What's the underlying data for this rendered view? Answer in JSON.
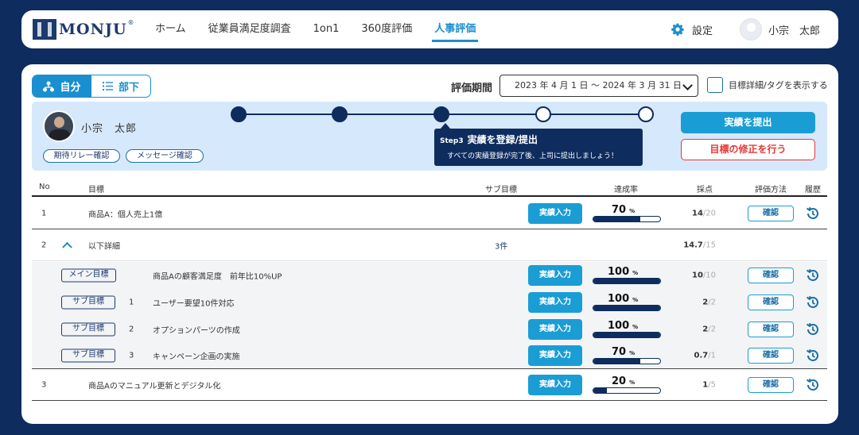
{
  "header": {
    "logo_text": "MONJU",
    "logo_reg": "®",
    "nav": [
      "ホーム",
      "従業員満足度調査",
      "1on1",
      "360度評価",
      "人事評価"
    ],
    "active_nav": "人事評価",
    "settings_label": "設定",
    "user_name": "小宗　太郎"
  },
  "toolbar": {
    "self_label": "自分",
    "subordinate_label": "部下",
    "period_label": "評価期間",
    "period_value": "2023 年 4 月 1 日 〜 2024 年 3 月 31 日",
    "show_detail_label": "目標詳細/タグを表示する"
  },
  "step_panel": {
    "person_name": "小宗　太郎",
    "relay_button": "期待リレー確認",
    "message_button": "メッセージ確認",
    "steps_total": 5,
    "steps_completed": 3,
    "tip_step": "Step3",
    "tip_title": "実績を登録/提出",
    "tip_desc": "すべての実績登録が完了後、上司に提出しましょう！",
    "submit_button": "実績を提出",
    "fix_button": "目標の修正を行う"
  },
  "table": {
    "headers": {
      "no": "No",
      "goal": "目標",
      "sub_goal": "サブ目標",
      "rate": "達成率",
      "score": "採点",
      "method": "評価方法",
      "history": "履歴"
    },
    "input_label": "実績入力",
    "confirm_label": "確認",
    "percent_sign": "%",
    "rows": [
      {
        "no": "1",
        "goal": "商品A：個人売上1億",
        "rate": 70,
        "score": "14",
        "score_max": "/20"
      },
      {
        "no": "2",
        "goal": "以下詳細",
        "sub_count": "3件",
        "score": "14.7",
        "score_max": "/15"
      },
      {
        "tag": "メイン目標",
        "goal": "商品Aの顧客満足度　前年比10%UP",
        "rate": 100,
        "score": "10",
        "score_max": "/10"
      },
      {
        "tag": "サブ目標",
        "sub_no": "1",
        "goal": "ユーザー要望10件対応",
        "rate": 100,
        "score": "2",
        "score_max": "/2"
      },
      {
        "tag": "サブ目標",
        "sub_no": "2",
        "goal": "オプションパーツの作成",
        "rate": 100,
        "score": "2",
        "score_max": "/2"
      },
      {
        "tag": "サブ目標",
        "sub_no": "3",
        "goal": "キャンペーン企画の実施",
        "rate": 70,
        "score": "0.7",
        "score_max": "/1"
      },
      {
        "no": "3",
        "goal": "商品Aのマニュアル更新とデジタル化",
        "rate": 20,
        "score": "1",
        "score_max": "/5"
      }
    ]
  },
  "colors": {
    "navy": "#0e2c5e",
    "accent": "#1a9dd4",
    "panel": "#d6e8fb",
    "danger": "#e53935"
  }
}
